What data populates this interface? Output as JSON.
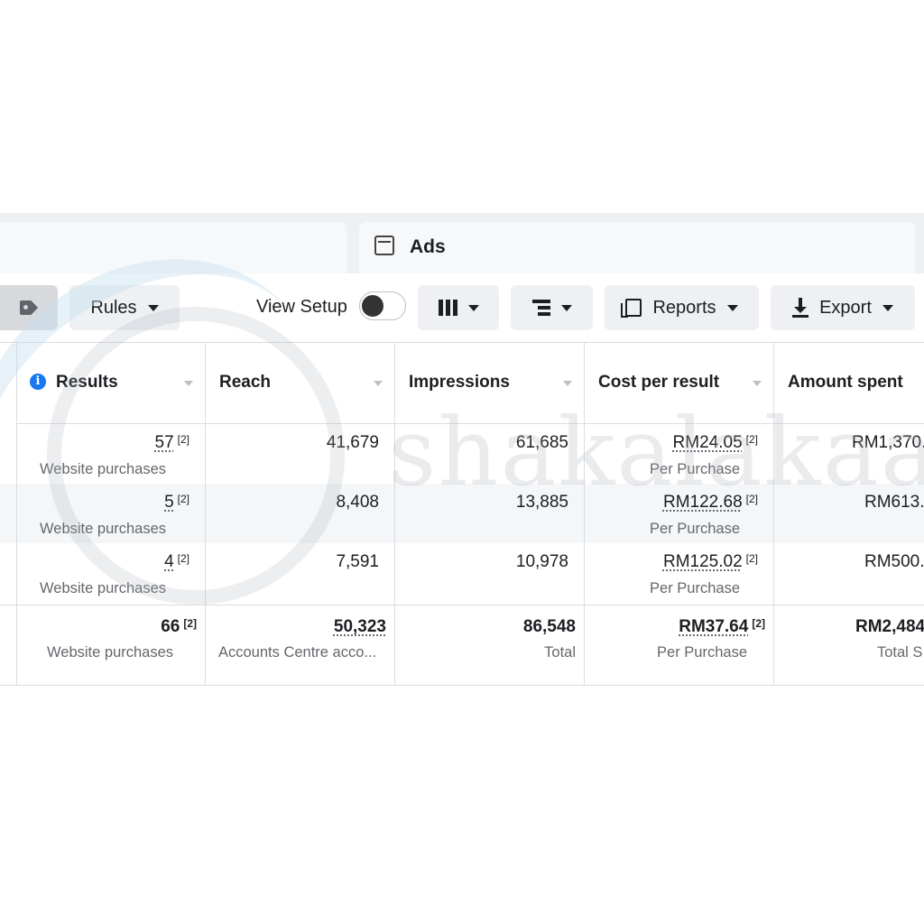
{
  "tabs": {
    "ads_label": "Ads"
  },
  "toolbar": {
    "rules_label": "Rules",
    "view_setup_label": "View Setup",
    "reports_label": "Reports",
    "export_label": "Export"
  },
  "table": {
    "headers": {
      "results": "Results",
      "reach": "Reach",
      "impressions": "Impressions",
      "cost_per_result": "Cost per result",
      "amount_spent": "Amount spent"
    },
    "rows": [
      {
        "results": "57",
        "results_note": "[2]",
        "results_sub": "Website purchases",
        "reach": "41,679",
        "impressions": "61,685",
        "cost": "RM24.05",
        "cost_note": "[2]",
        "cost_sub": "Per Purchase",
        "amount": "RM1,370."
      },
      {
        "results": "5",
        "results_note": "[2]",
        "results_sub": "Website purchases",
        "reach": "8,408",
        "impressions": "13,885",
        "cost": "RM122.68",
        "cost_note": "[2]",
        "cost_sub": "Per Purchase",
        "amount": "RM613."
      },
      {
        "results": "4",
        "results_note": "[2]",
        "results_sub": "Website purchases",
        "reach": "7,591",
        "impressions": "10,978",
        "cost": "RM125.02",
        "cost_note": "[2]",
        "cost_sub": "Per Purchase",
        "amount": "RM500."
      }
    ],
    "total": {
      "results": "66",
      "results_note": "[2]",
      "results_sub": "Website purchases",
      "reach": "50,323",
      "reach_sub": "Accounts Centre acco...",
      "impressions": "86,548",
      "impressions_sub": "Total",
      "cost": "RM37.64",
      "cost_note": "[2]",
      "cost_sub": "Per Purchase",
      "amount": "RM2,484",
      "amount_sub": "Total S"
    }
  },
  "watermark": {
    "text": "shakalakaa"
  },
  "colors": {
    "info_blue": "#1877f2",
    "header_bg": "#eef0f3",
    "alt_row": "#f5f6f7"
  },
  "icons": [
    "tag-icon",
    "columns-icon",
    "breakdown-icon",
    "reports-icon",
    "export-icon",
    "ads-icon",
    "info-icon",
    "sort-caret-icon"
  ]
}
